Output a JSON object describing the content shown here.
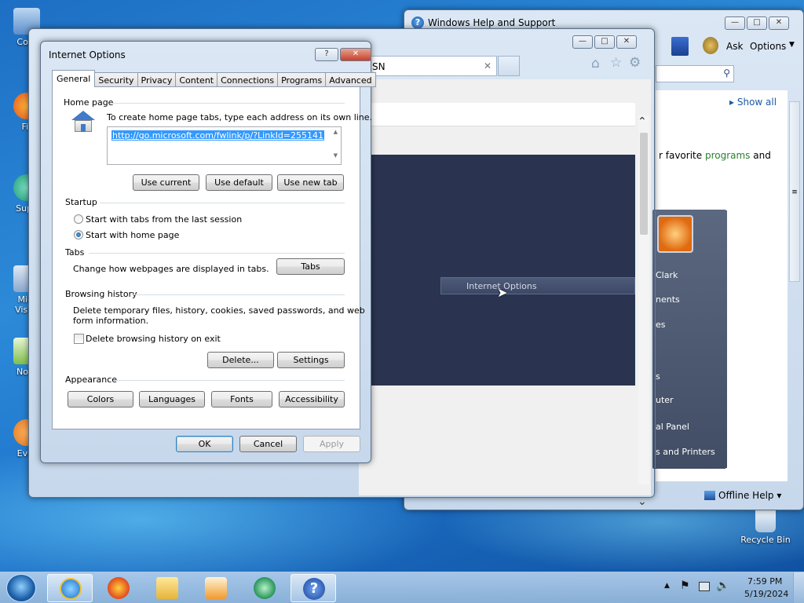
{
  "desktop": {
    "icons": [
      {
        "label": "Com"
      },
      {
        "label": "Fir"
      },
      {
        "label": "Supe"
      },
      {
        "label": "Micr",
        "label2": "Visua"
      },
      {
        "label": "Note"
      },
      {
        "label": "Ever"
      }
    ],
    "recycle_bin": "Recycle Bin"
  },
  "help_window": {
    "title": "Windows Help and Support",
    "ask_label": "Ask",
    "options_label": "Options",
    "show_all": "Show all",
    "body_prefix": "r favorite ",
    "body_link": "programs",
    "body_suffix": " and",
    "offline_help": "Offline Help"
  },
  "ie_window": {
    "tab_suffix": "SN",
    "start_menu_items": [
      "Clark",
      "nents",
      "es",
      "s",
      "uter",
      "al Panel",
      "s and Printers"
    ],
    "highlight_item": "Internet Options"
  },
  "dialog": {
    "title": "Internet Options",
    "tabs": [
      "General",
      "Security",
      "Privacy",
      "Content",
      "Connections",
      "Programs",
      "Advanced"
    ],
    "home_page": {
      "heading": "Home page",
      "instruction": "To create home page tabs, type each address on its own line.",
      "url": "http://go.microsoft.com/fwlink/p/?LinkId=255141",
      "use_current": "Use current",
      "use_default": "Use default",
      "use_new_tab": "Use new tab"
    },
    "startup": {
      "heading": "Startup",
      "option1": "Start with tabs from the last session",
      "option2": "Start with home page",
      "selected": 2
    },
    "tabs_section": {
      "heading": "Tabs",
      "description": "Change how webpages are displayed in tabs.",
      "button": "Tabs"
    },
    "browsing_history": {
      "heading": "Browsing history",
      "description_line1": "Delete temporary files, history, cookies, saved passwords, and web",
      "description_line2": "form information.",
      "delete_on_exit": "Delete browsing history on exit",
      "delete_on_exit_checked": false,
      "delete_button": "Delete...",
      "settings_button": "Settings"
    },
    "appearance": {
      "heading": "Appearance",
      "colors": "Colors",
      "languages": "Languages",
      "fonts": "Fonts",
      "accessibility": "Accessibility"
    },
    "ok": "OK",
    "cancel": "Cancel",
    "apply": "Apply"
  },
  "taskbar": {
    "apps": [
      "start-orb",
      "internet-explorer",
      "firefox",
      "file-explorer",
      "media-player",
      "green-app",
      "help-and-support"
    ],
    "time": "7:59 PM",
    "date": "5/19/2024"
  }
}
